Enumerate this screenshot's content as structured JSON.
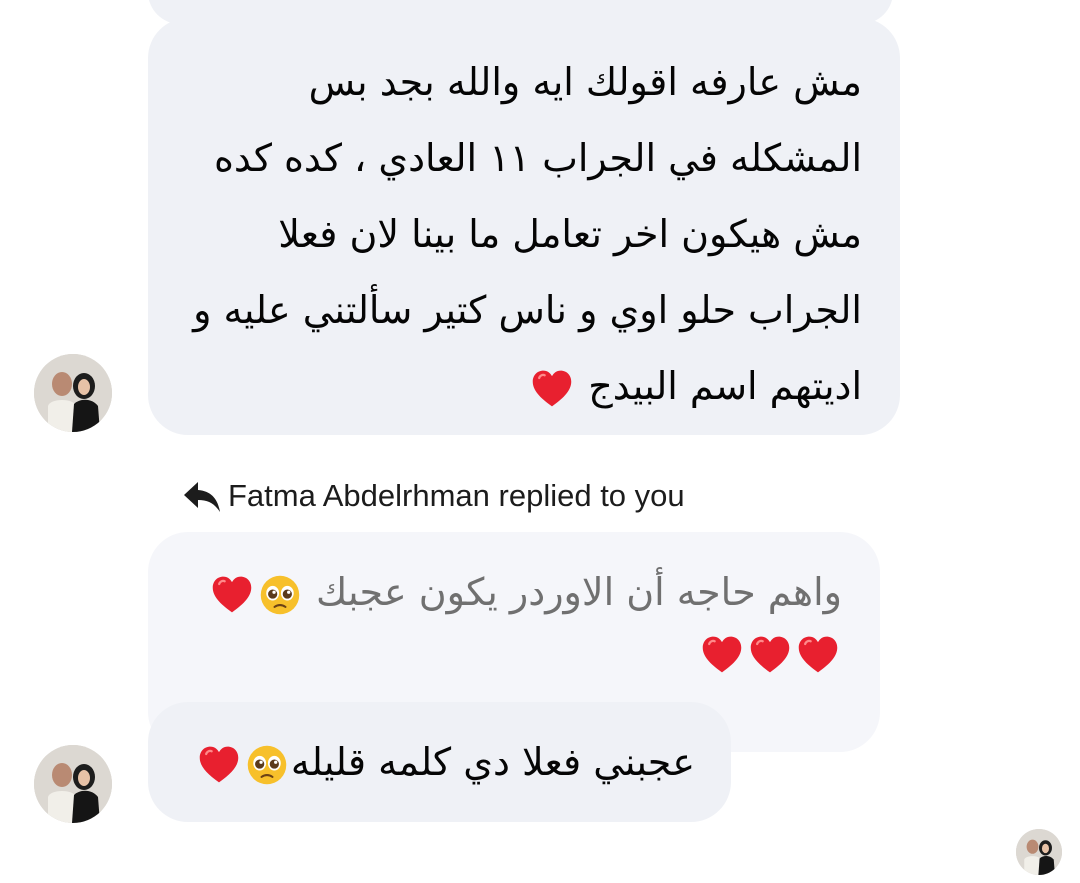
{
  "conversation": {
    "message_long": {
      "lines": [
        "مش عارفه اقولك ايه والله بجد بس",
        "المشكله في الجراب ١١ العادي ، كده كده",
        "مش هيكون اخر تعامل ما بينا لان فعلا",
        "الجراب حلو اوي و ناس كتير سألتني عليه و",
        "اديتهم اسم البيدج"
      ],
      "trailing_emoji": "red-heart-emoji"
    },
    "reply_header": {
      "icon": "reply-arrow-icon",
      "text": "Fatma Abdelrhman replied to you"
    },
    "quoted_message": {
      "line1": "واهم حاجه أن الاوردر يكون عجبك",
      "line1_emoji": [
        "pleading-face-emoji",
        "red-heart-emoji"
      ],
      "line2_emoji": [
        "red-heart-emoji",
        "red-heart-emoji",
        "red-heart-emoji"
      ]
    },
    "reply_message": {
      "text": "عجبني فعلا دي كلمه قليله",
      "emoji": [
        "pleading-face-emoji",
        "red-heart-emoji"
      ]
    }
  },
  "colors": {
    "bubble_background": "#eff1f6",
    "quoted_bubble_background": "#f5f6fa",
    "text_primary": "#050505",
    "text_quoted": "#707070",
    "heart_red": "#e8202f"
  }
}
